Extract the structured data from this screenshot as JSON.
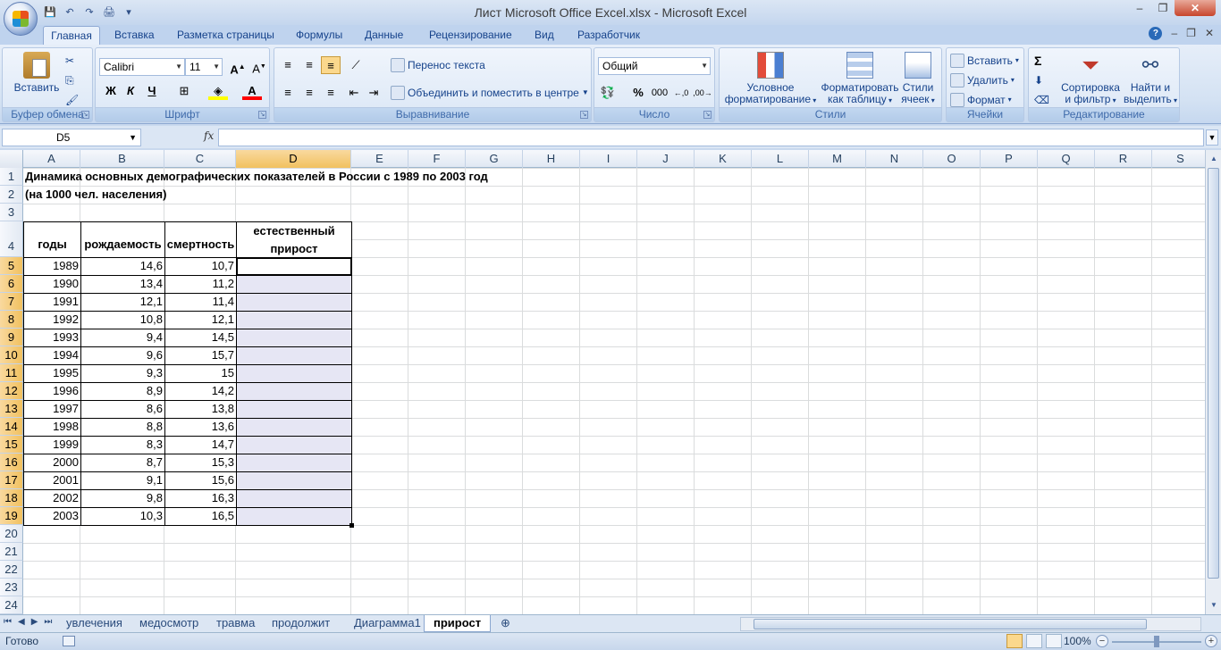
{
  "window": {
    "title": "Лист Microsoft Office Excel.xlsx - Microsoft Excel",
    "minimize": "‒",
    "maximize": "❐",
    "close": "✕"
  },
  "ribbon_tabs": [
    "Главная",
    "Вставка",
    "Разметка страницы",
    "Формулы",
    "Данные",
    "Рецензирование",
    "Вид",
    "Разработчик"
  ],
  "ribbon": {
    "clipboard": {
      "label": "Буфер обмена",
      "paste": "Вставить"
    },
    "font": {
      "label": "Шрифт",
      "name": "Calibri",
      "size": "11",
      "bold": "Ж",
      "italic": "К",
      "underline": "Ч"
    },
    "alignment": {
      "label": "Выравнивание",
      "wrap": "Перенос текста",
      "merge": "Объединить и поместить в центре"
    },
    "number": {
      "label": "Число",
      "format": "Общий",
      "percent": "%",
      "thousands": "000"
    },
    "styles": {
      "label": "Стили",
      "conditional": "Условное\nформатирование",
      "conditional_l1": "Условное",
      "conditional_l2": "форматирование",
      "astable_l1": "Форматировать",
      "astable_l2": "как таблицу",
      "cellstyles_l1": "Стили",
      "cellstyles_l2": "ячеек"
    },
    "cells": {
      "label": "Ячейки",
      "insert": "Вставить",
      "delete": "Удалить",
      "format": "Формат"
    },
    "editing": {
      "label": "Редактирование",
      "sum": "Σ",
      "sort_l1": "Сортировка",
      "sort_l2": "и фильтр",
      "find_l1": "Найти и",
      "find_l2": "выделить"
    }
  },
  "formula_bar": {
    "name_box": "D5",
    "fx": "fx",
    "value": ""
  },
  "columns": [
    "A",
    "B",
    "C",
    "D",
    "E",
    "F",
    "G",
    "H",
    "I",
    "J",
    "K",
    "L",
    "M",
    "N",
    "O",
    "P",
    "Q",
    "R",
    "S"
  ],
  "rows": [
    "1",
    "2",
    "3",
    "4",
    "5",
    "6",
    "7",
    "8",
    "9",
    "10",
    "11",
    "12",
    "13",
    "14",
    "15",
    "16",
    "17",
    "18",
    "19",
    "20",
    "21",
    "22",
    "23",
    "24"
  ],
  "sheet": {
    "title1": "Динамика основных демографических показателей в России с 1989 по 2003 год",
    "title2": "(на 1000 чел. населения)",
    "headers": {
      "years": "годы",
      "birth": "рождаемость",
      "death": "смертность",
      "growth_l1": "естественный",
      "growth_l2": "прирост"
    },
    "data": [
      {
        "year": "1989",
        "birth": "14,6",
        "death": "10,7"
      },
      {
        "year": "1990",
        "birth": "13,4",
        "death": "11,2"
      },
      {
        "year": "1991",
        "birth": "12,1",
        "death": "11,4"
      },
      {
        "year": "1992",
        "birth": "10,8",
        "death": "12,1"
      },
      {
        "year": "1993",
        "birth": "9,4",
        "death": "14,5"
      },
      {
        "year": "1994",
        "birth": "9,6",
        "death": "15,7"
      },
      {
        "year": "1995",
        "birth": "9,3",
        "death": "15"
      },
      {
        "year": "1996",
        "birth": "8,9",
        "death": "14,2"
      },
      {
        "year": "1997",
        "birth": "8,6",
        "death": "13,8"
      },
      {
        "year": "1998",
        "birth": "8,8",
        "death": "13,6"
      },
      {
        "year": "1999",
        "birth": "8,3",
        "death": "14,7"
      },
      {
        "year": "2000",
        "birth": "8,7",
        "death": "15,3"
      },
      {
        "year": "2001",
        "birth": "9,1",
        "death": "15,6"
      },
      {
        "year": "2002",
        "birth": "9,8",
        "death": "16,3"
      },
      {
        "year": "2003",
        "birth": "10,3",
        "death": "16,5"
      }
    ]
  },
  "sheet_tabs": [
    "увлечения",
    "медосмотр",
    "травма",
    "продолжит",
    "Диаграмма1",
    "прирост"
  ],
  "active_sheet_tab": "прирост",
  "status": {
    "ready": "Готово",
    "zoom": "100%"
  }
}
